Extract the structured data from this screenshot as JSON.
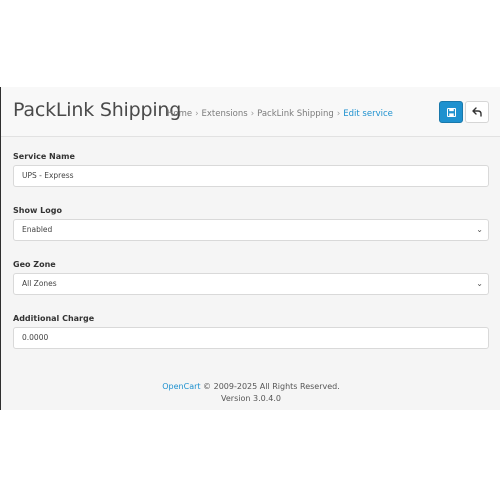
{
  "header": {
    "title": "PackLink Shipping",
    "breadcrumb": [
      "Home",
      "Extensions",
      "PackLink Shipping",
      "Edit service"
    ],
    "breadcrumb_separator": "›"
  },
  "toolbar": {
    "save_icon": "floppy-disk-icon",
    "back_icon": "reply-arrow-icon",
    "accent_color": "#1e91cf"
  },
  "form": {
    "service_name": {
      "label": "Service Name",
      "value": "UPS - Express"
    },
    "show_logo": {
      "label": "Show Logo",
      "value": "Enabled"
    },
    "geo_zone": {
      "label": "Geo Zone",
      "value": "All Zones"
    },
    "additional_charge": {
      "label": "Additional Charge",
      "value": "0.0000"
    }
  },
  "footer": {
    "link": "OpenCart",
    "copyright": " © 2009-2025 All Rights Reserved.",
    "version": "Version 3.0.4.0"
  }
}
